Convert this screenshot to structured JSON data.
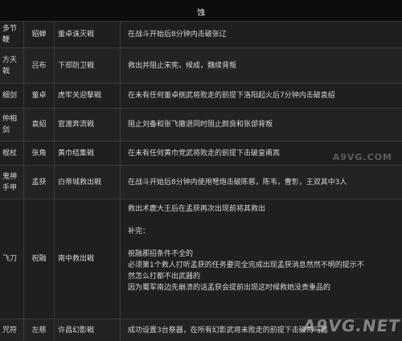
{
  "header": {
    "title": "蚀"
  },
  "rows": [
    {
      "name": "多节鞭",
      "holder": "貂蝉",
      "battle": "董卓诛灭戦",
      "condition": "在战斗开始后8分钟内击破张辽"
    },
    {
      "name": "方天戟",
      "holder": "吕布",
      "battle": "下邳防卫戦",
      "condition": "救出并阻止宋宪，候成，魏续背叛"
    },
    {
      "name": "细剑",
      "holder": "董卓",
      "battle": "虎牢关迎撃戦",
      "condition": "在未有任何董卓侧武将败走的前提下洛阳起火后7分钟内击破袁绍"
    },
    {
      "name": "仲相剑",
      "holder": "袁绍",
      "battle": "官渡奔流戦",
      "condition": "阻止刘备和张飞撤退同时阻止颜良和张郃背叛"
    },
    {
      "name": "棍杖",
      "holder": "张角",
      "battle": "黄巾结集戦",
      "condition": "在未有任何黄巾党武将败走的前提下击破皇甫嵩"
    },
    {
      "name": "鬼神手甲",
      "holder": "孟获",
      "battle": "白帝城救出戦",
      "condition": "在战斗开始后8分钟内使用弩炮击破陈慈，陈韦，曹彰，王双其中3人"
    },
    {
      "name": "飞刀",
      "holder": "祝融",
      "battle": "南中救出戦",
      "condition_lines": [
        "救出术鹿大王后在孟获再次出现前将其救出",
        "",
        "补完：",
        "",
        "祝融那招条件不全的",
        "必须第1个救人打听孟获的任务要完全完成出现孟获消息然然不明的提示不",
        "然怎么打都不出武器的",
        "因为蜀军南边先崩溃的话孟获会提前出现这时候救她没贵重品的"
      ]
    },
    {
      "name": "咒符",
      "holder": "左慈",
      "battle": "许昌幻影戦",
      "condition": "成功设置3台祭器，在所有幻影武将未败走的前提下击破司马懿"
    }
  ],
  "watermark": {
    "main": "A9VG.NET",
    "secondary": "A9VG.COM"
  }
}
